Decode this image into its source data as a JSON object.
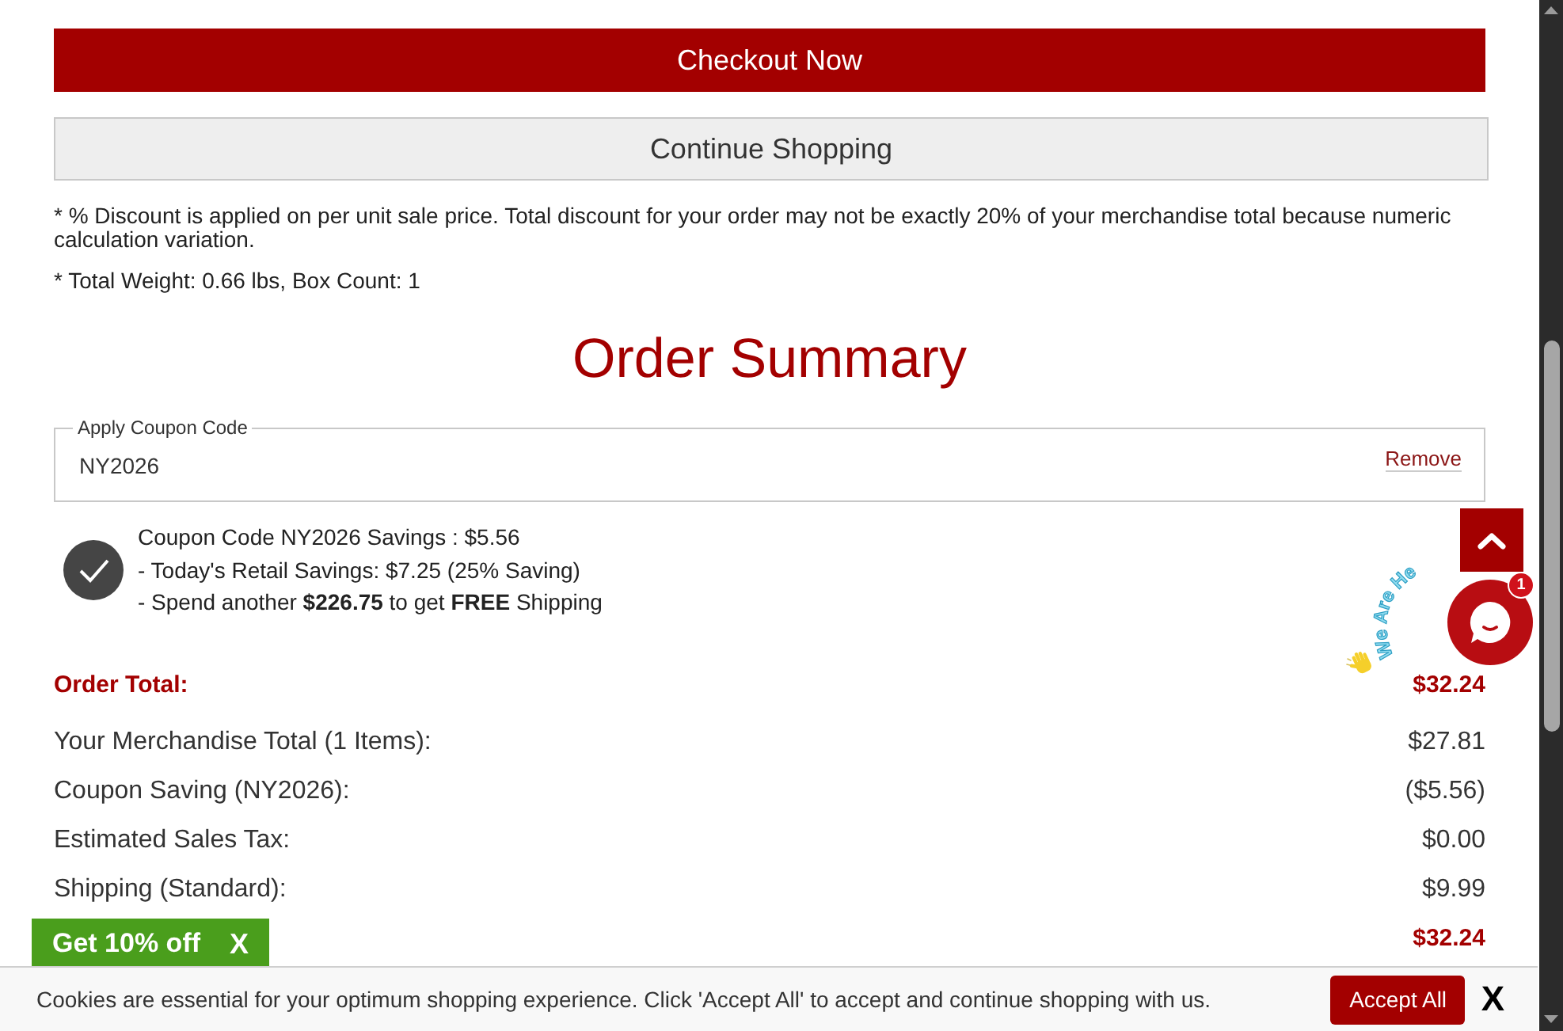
{
  "actions": [
    {
      "kind": "primary",
      "label": "Checkout Now"
    },
    {
      "kind": "secondary",
      "label": "Continue Shopping"
    }
  ],
  "notes": [
    "* % Discount is applied on per unit sale price. Total discount for your order may not be exactly 20% of your merchandise total because numeric calculation variation.",
    "* Total Weight: 0.66 lbs, Box Count: 1"
  ],
  "order_summary": {
    "title": "Order Summary",
    "coupon_field": {
      "label": "Apply Coupon Code",
      "value": "NY2026",
      "action": "Remove"
    },
    "coupon_lines": [
      "Coupon Code NY2026 Savings : $5.56",
      "- Today's Retail Savings: $7.25 (25% Saving)",
      "- Spend another **$226.75** to get **FREE** Shipping"
    ],
    "totals": [
      {
        "kind": "total",
        "label": "Order Total:",
        "value": "$32.24"
      },
      {
        "kind": "line",
        "label": "Your Merchandise Total (1 Items):",
        "value": "$27.81"
      },
      {
        "kind": "line",
        "label": "Coupon Saving (NY2026):",
        "value": "($5.56)"
      },
      {
        "kind": "line",
        "label": "Estimated Sales Tax:",
        "value": "$0.00"
      },
      {
        "kind": "line",
        "label": "Shipping (Standard):",
        "value": "$9.99"
      },
      {
        "kind": "total",
        "value": "$32.24"
      }
    ]
  },
  "chat_widget": {
    "caption": "We Are He",
    "unread": "1"
  },
  "promo_tab": {
    "label": "Get 10% off",
    "close": "X"
  },
  "cookie_banner": {
    "message": "Cookies are essential for your optimum shopping experience. Click 'Accept All' to accept and continue shopping with us.",
    "accept": "Accept All",
    "close": "X"
  }
}
